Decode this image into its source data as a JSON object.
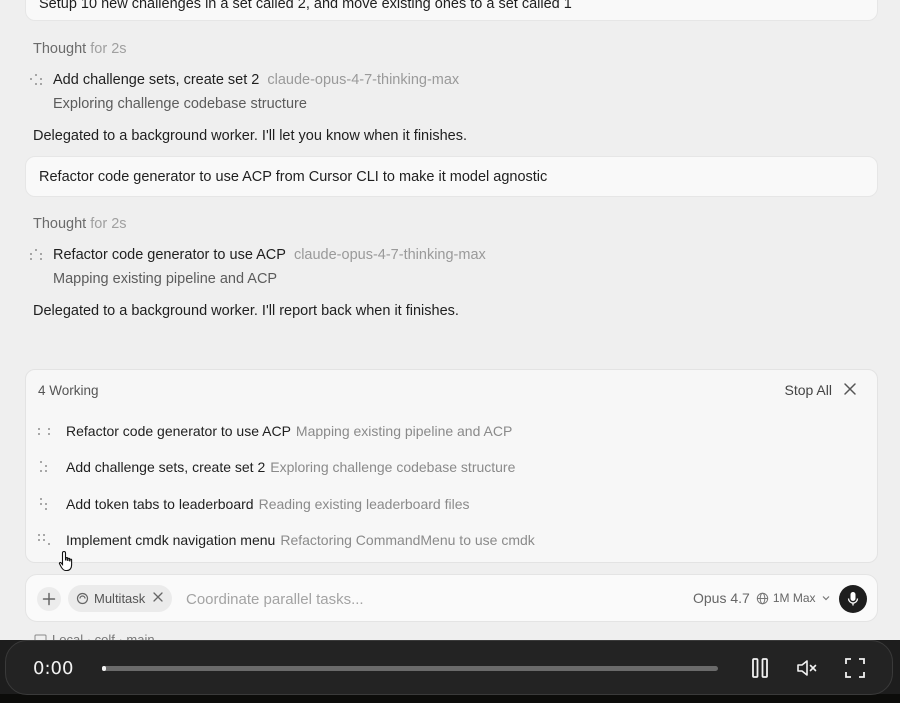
{
  "messages": {
    "user_1": "Setup 10 new challenges in a set called 2, and move existing ones to a set called 1",
    "thought_1": {
      "label": "Thought",
      "duration": "for 2s"
    },
    "task_1": {
      "title": "Add challenge sets, create set 2",
      "model": "claude-opus-4-7-thinking-max",
      "status": "Exploring challenge codebase structure"
    },
    "delegated_1": "Delegated to a background worker. I'll let you know when it finishes.",
    "user_2": "Refactor code generator to use ACP from Cursor CLI to make it model agnostic",
    "thought_2": {
      "label": "Thought",
      "duration": "for 2s"
    },
    "task_2": {
      "title": "Refactor code generator to use ACP",
      "model": "claude-opus-4-7-thinking-max",
      "status": "Mapping existing pipeline and ACP"
    },
    "delegated_2": "Delegated to a background worker. I'll report back when it finishes."
  },
  "working_panel": {
    "header": "4 Working",
    "stop_all": "Stop All",
    "close_icon": "close-icon",
    "items": [
      {
        "title": "Refactor code generator to use ACP",
        "status": "Mapping existing pipeline and ACP"
      },
      {
        "title": "Add challenge sets, create set 2",
        "status": "Exploring challenge codebase structure"
      },
      {
        "title": "Add token tabs to leaderboard",
        "status": "Reading existing leaderboard files"
      },
      {
        "title": "Implement cmdk navigation menu",
        "status": "Refactoring CommandMenu to use cmdk"
      }
    ]
  },
  "composer": {
    "chip_label": "Multitask",
    "placeholder": "Coordinate parallel tasks...",
    "model": "Opus 4.7",
    "context": "1M Max"
  },
  "status_line": "Local · colf · main",
  "video": {
    "time": "0:00",
    "progress": 0.002
  },
  "colors": {
    "background": "#efefef",
    "mic_button": "#1e1e1e",
    "video_bar": "#232323"
  }
}
